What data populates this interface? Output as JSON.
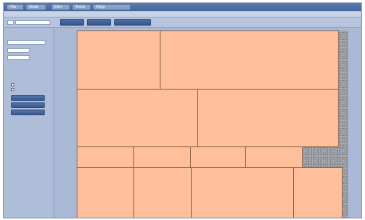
{
  "menubar": {
    "items": [
      {
        "label": "File"
      },
      {
        "label": "View"
      },
      {
        "label": "Edit"
      },
      {
        "label": "Tools"
      },
      {
        "label": "Help"
      }
    ]
  },
  "subbar": {
    "left_text": "",
    "center_text": ""
  },
  "ribbon": {
    "search_value": "",
    "buttons": [
      {
        "label": ""
      },
      {
        "label": ""
      },
      {
        "label": ""
      }
    ]
  },
  "sidebar": {
    "heading": "",
    "field_label": "",
    "checkboxes": [
      {
        "label": ""
      },
      {
        "label": ""
      }
    ],
    "buttons": [
      {
        "label": ""
      },
      {
        "label": ""
      },
      {
        "label": ""
      }
    ]
  },
  "treemap": {
    "tiles": [
      {
        "label": ""
      },
      {
        "label": ""
      },
      {
        "label": ""
      },
      {
        "label": ""
      },
      {
        "label": ""
      },
      {
        "label": ""
      },
      {
        "label": ""
      },
      {
        "label": ""
      },
      {
        "label": ""
      },
      {
        "label": ""
      },
      {
        "label": ""
      },
      {
        "label": ""
      }
    ]
  },
  "colors": {
    "tile_fill": "#ffbf9b",
    "tile_border": "#946a52",
    "app_background": "#a9b9d6",
    "menubar": "#46659a",
    "button": "#3a5a90"
  }
}
